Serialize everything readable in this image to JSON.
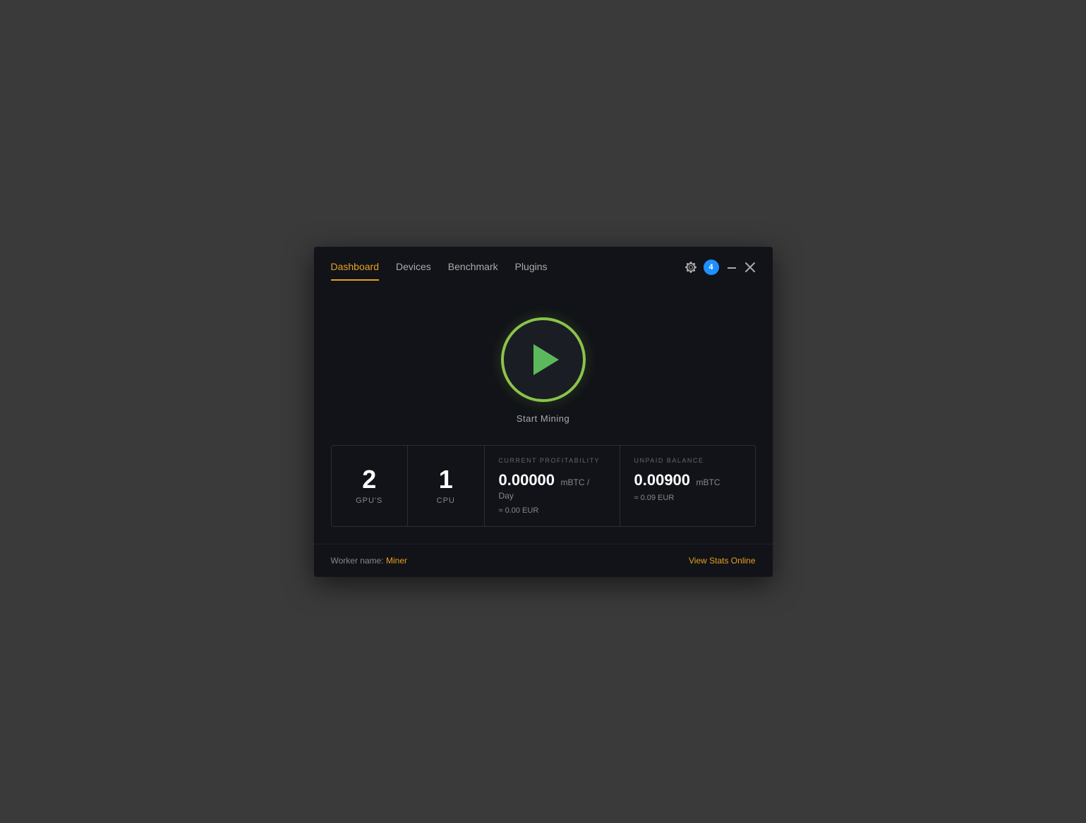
{
  "nav": {
    "links": [
      {
        "id": "dashboard",
        "label": "Dashboard",
        "active": true
      },
      {
        "id": "devices",
        "label": "Devices",
        "active": false
      },
      {
        "id": "benchmark",
        "label": "Benchmark",
        "active": false
      },
      {
        "id": "plugins",
        "label": "Plugins",
        "active": false
      }
    ],
    "notification_count": "4"
  },
  "mining": {
    "start_label": "Start Mining"
  },
  "stats": {
    "gpus": {
      "value": "2",
      "label": "GPU'S"
    },
    "cpus": {
      "value": "1",
      "label": "CPU"
    },
    "profitability": {
      "section_label": "CURRENT PROFITABILITY",
      "main_value": "0.00000",
      "main_unit": "mBTC / Day",
      "sub_value": "≈ 0.00 EUR"
    },
    "balance": {
      "section_label": "UNPAID BALANCE",
      "main_value": "0.00900",
      "main_unit": "mBTC",
      "sub_value": "≈ 0.09 EUR"
    }
  },
  "footer": {
    "worker_label": "Worker name:",
    "worker_name": "Miner",
    "view_stats_label": "View Stats Online"
  }
}
